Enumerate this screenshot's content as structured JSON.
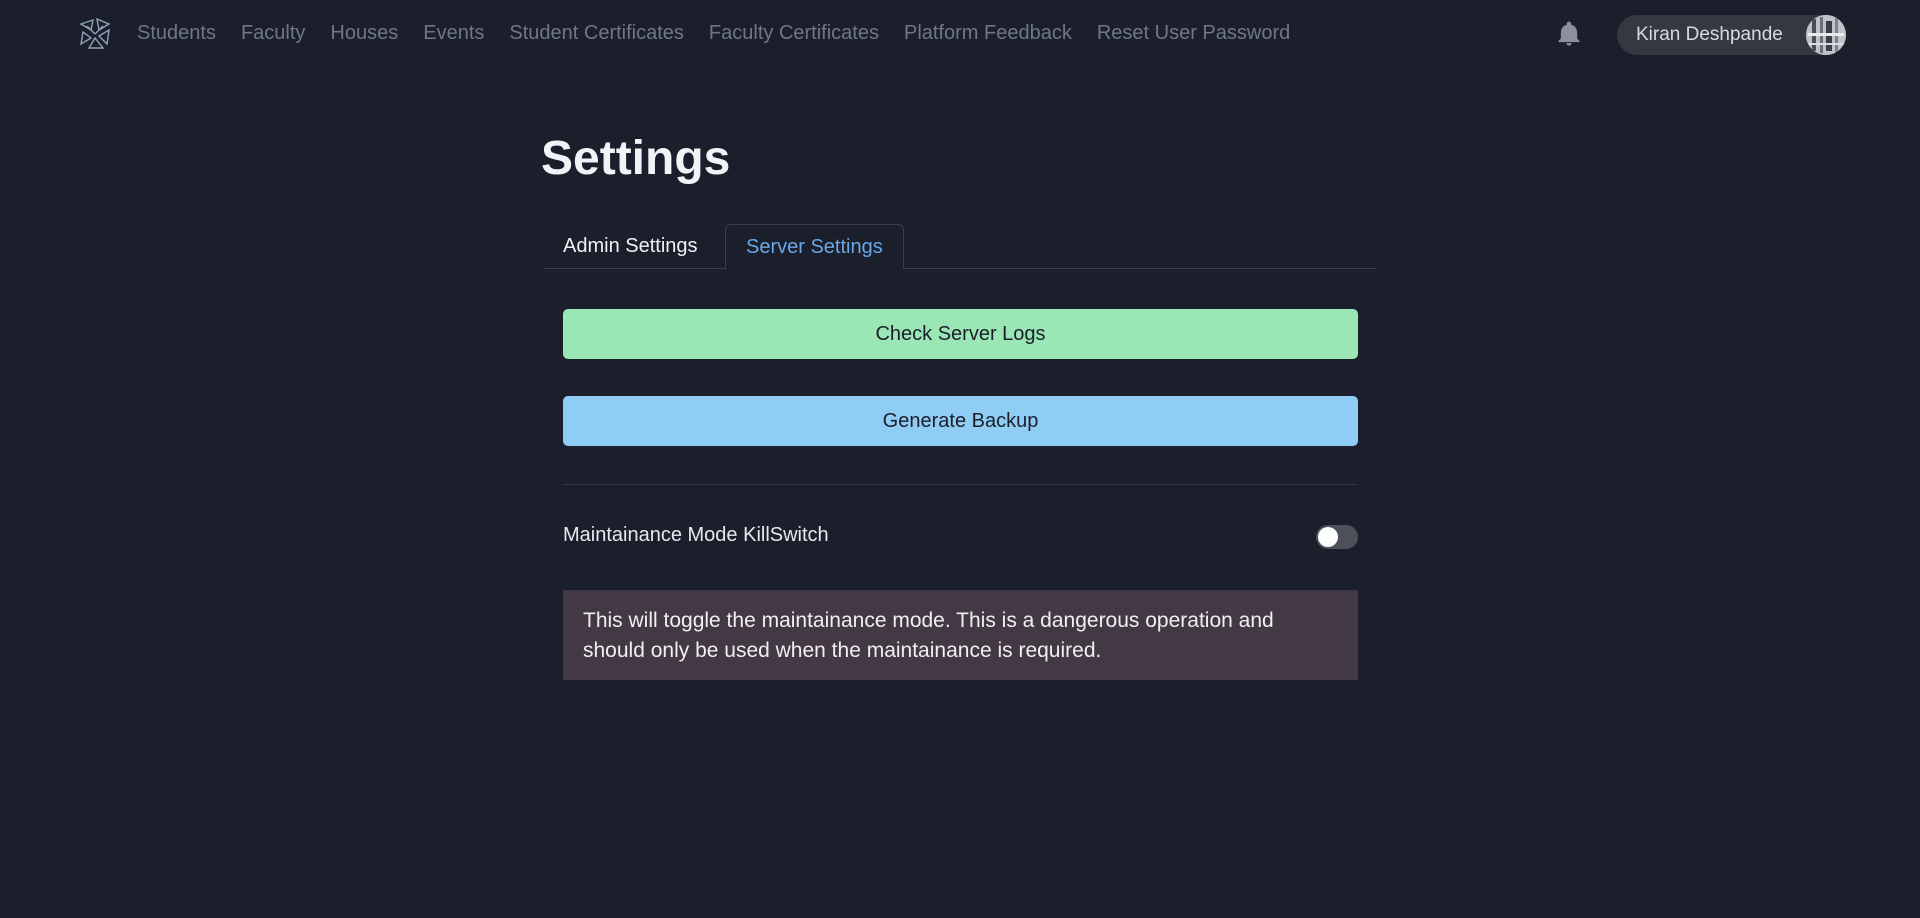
{
  "nav": {
    "logo_icon": "star-burst-logo",
    "links": [
      {
        "label": "Students"
      },
      {
        "label": "Faculty"
      },
      {
        "label": "Houses"
      },
      {
        "label": "Events"
      },
      {
        "label": "Student Certificates"
      },
      {
        "label": "Faculty Certificates"
      },
      {
        "label": "Platform Feedback"
      },
      {
        "label": "Reset User Password"
      }
    ],
    "notification_icon": "bell-icon",
    "user": {
      "name": "Kiran Deshpande"
    }
  },
  "page": {
    "title": "Settings",
    "tabs": [
      {
        "label": "Admin Settings",
        "active": false
      },
      {
        "label": "Server Settings",
        "active": true
      }
    ]
  },
  "server_settings": {
    "check_logs_label": "Check Server Logs",
    "generate_backup_label": "Generate Backup",
    "killswitch_label": "Maintainance Mode KillSwitch",
    "killswitch_on": false,
    "warning_text": "This will toggle the maintainance mode. This is a dangerous operation and should only be used when the maintainance is required."
  },
  "colors": {
    "background": "#1b1f2b",
    "check_logs": "#9ae6b4",
    "backup": "#90cdf4",
    "active_tab": "#6aa7e6",
    "warning_bg": "#423944"
  }
}
